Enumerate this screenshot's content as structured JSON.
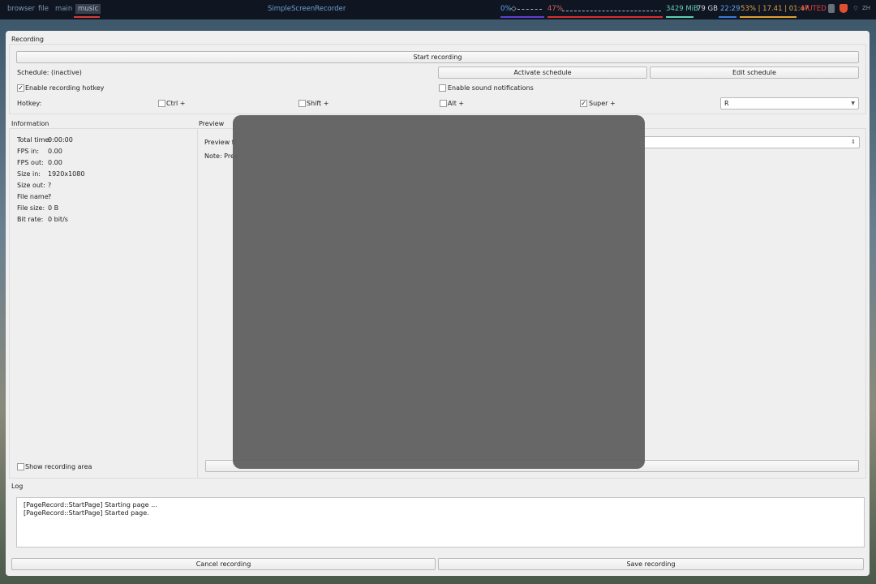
{
  "topbar": {
    "workspaces": [
      "browser",
      "file",
      "main",
      "music"
    ],
    "active_workspace": "music",
    "title": "SimpleScreenRecorder",
    "cpu": "0%",
    "volume": "47%",
    "mem": "3429 MiB",
    "disk": "79 GB",
    "time": "22:29",
    "battery": "53% | 17.41 | 01:47",
    "muted": "MUTED",
    "lang": "ZH",
    "accent": "#d83a3a"
  },
  "recording": {
    "section_title": "Recording",
    "start_button": "Start recording",
    "schedule_label": "Schedule: (inactive)",
    "activate_schedule": "Activate schedule",
    "edit_schedule": "Edit schedule",
    "enable_hotkey_label": "Enable recording hotkey",
    "enable_hotkey_checked": true,
    "sound_notifications_label": "Enable sound notifications",
    "sound_notifications_checked": false,
    "hotkey_label": "Hotkey:",
    "ctrl": "Ctrl +",
    "shift": "Shift +",
    "alt": "Alt +",
    "super": "Super +",
    "key": "R"
  },
  "information": {
    "section_title": "Information",
    "rows": [
      {
        "label": "Total time:",
        "value": "0:00:00"
      },
      {
        "label": "FPS in:",
        "value": "0.00"
      },
      {
        "label": "FPS out:",
        "value": "0.00"
      },
      {
        "label": "Size in:",
        "value": "1920x1080"
      },
      {
        "label": "Size out:",
        "value": "?"
      },
      {
        "label": "File name:",
        "value": "?"
      },
      {
        "label": "File size:",
        "value": "0 B"
      },
      {
        "label": "Bit rate:",
        "value": "0 bit/s"
      }
    ],
    "show_area_label": "Show recording area"
  },
  "preview": {
    "section_title": "Preview",
    "frame_rate_label": "Preview fr",
    "note_label": "Note: Prev"
  },
  "log": {
    "section_title": "Log",
    "lines": [
      "[PageRecord::StartPage] Starting page ...",
      "[PageRecord::StartPage] Started page."
    ]
  },
  "footer": {
    "cancel": "Cancel recording",
    "save": "Save recording"
  }
}
